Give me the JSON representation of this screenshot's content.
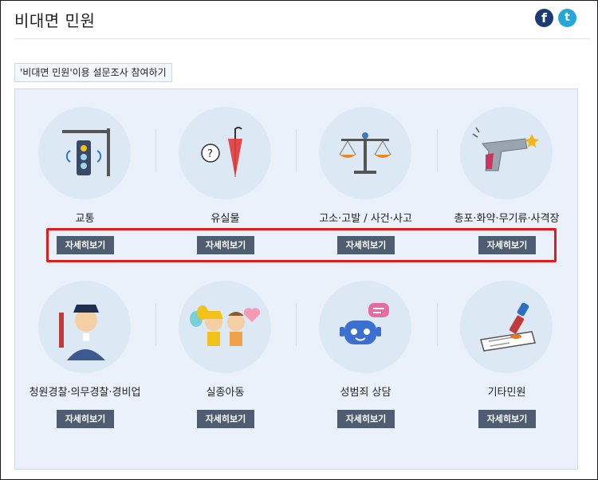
{
  "page": {
    "title": "비대면 민원",
    "social": {
      "facebook_glyph": "f",
      "twitter_glyph": "t"
    },
    "survey_link": "'비대면 민원'이용 설문조사 참여하기"
  },
  "services": [
    {
      "label": "교통",
      "button": "자세히보기",
      "icon": "traffic-light-icon"
    },
    {
      "label": "유실물",
      "button": "자세히보기",
      "icon": "umbrella-question-icon"
    },
    {
      "label": "고소·고발 / 사건·사고",
      "button": "자세히보기",
      "icon": "scales-icon"
    },
    {
      "label": "총포·화약·무기류·사격장",
      "button": "자세히보기",
      "icon": "gun-icon"
    },
    {
      "label": "청원경찰·의무경찰·경비업",
      "button": "자세히보기",
      "icon": "police-officer-icon"
    },
    {
      "label": "실종아동",
      "button": "자세히보기",
      "icon": "children-balloons-icon"
    },
    {
      "label": "성범죄 상담",
      "button": "자세히보기",
      "icon": "chatbot-icon"
    },
    {
      "label": "기타민원",
      "button": "자세히보기",
      "icon": "stamp-document-icon"
    }
  ],
  "colors": {
    "button_bg": "#4f5d72",
    "panel_bg": "#eaf1fa",
    "highlight": "#e01b1b",
    "facebook": "#1d3b73",
    "twitter": "#27a6d8"
  }
}
